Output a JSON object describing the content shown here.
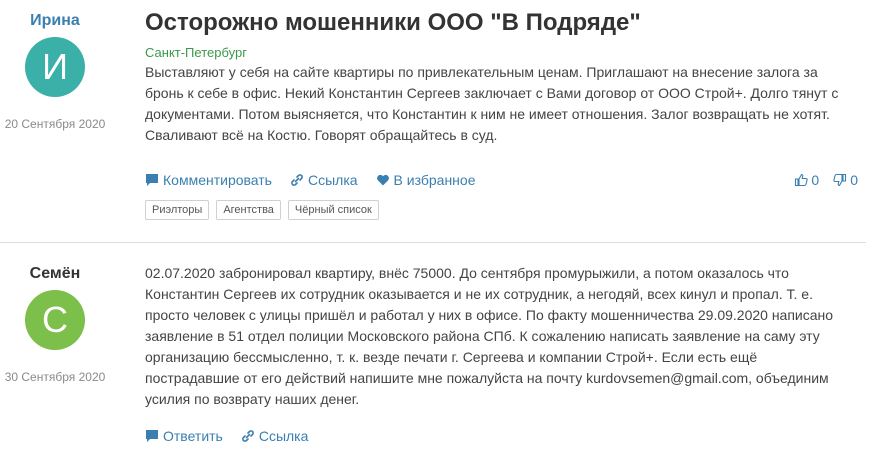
{
  "colors": {
    "link": "#3a7fb0",
    "city": "#3a9a4a",
    "avatar1": "#3bb0a8",
    "avatar2": "#7cbf4a"
  },
  "posts": [
    {
      "author": "Ирина",
      "avatar_letter": "И",
      "date": "20 Сентября 2020",
      "title": "Осторожно мошенники ООО \"В Подряде\"",
      "city": "Санкт-Петербург",
      "body": [
        "Выставляют у себя на сайте квартиры по привлекательным ценам. Приглашают на внесение залога за",
        "бронь к себе в офис. Некий Константин Сергеев заключает с Вами договор от ООО Строй+. Долго тянут с",
        "документами. Потом выясняется, что Константин к ним не имеет отношения. Залог возвращать не хотят.",
        "Сваливают всё на Костю. Говорят обращайтесь в суд."
      ],
      "actions": {
        "comment": "Комментировать",
        "link": "Ссылка",
        "favorite": "В избранное"
      },
      "likes": "0",
      "dislikes": "0",
      "tags": [
        "Риэлторы",
        "Агентства",
        "Чёрный список"
      ]
    },
    {
      "author": "Семён",
      "avatar_letter": "С",
      "date": "30 Сентября 2020",
      "body": [
        "02.07.2020 забронировал квартиру, внёс 75000. До сентября промурыжили, а потом оказалось что",
        "Константин Сергеев их сотрудник оказывается и не их сотрудник, а негодяй, всех кинул и пропал. Т. е.",
        "просто человек с улицы пришёл и работал у них в офисе. По факту мошенничества 29.09.2020 написано",
        "заявление в 51 отдел полиции Московского района СПб. К сожалению написать заявление на саму эту",
        "организацию бессмысленно, т. к. везде печати г. Сергеева и компании Строй+. Если есть ещё",
        "пострадавшие от его действий напишите мне пожалуйста на почту kurdovsemen@gmail.com, объединим",
        "усилия по возврату наших денег."
      ],
      "actions": {
        "reply": "Ответить",
        "link": "Ссылка"
      }
    }
  ]
}
